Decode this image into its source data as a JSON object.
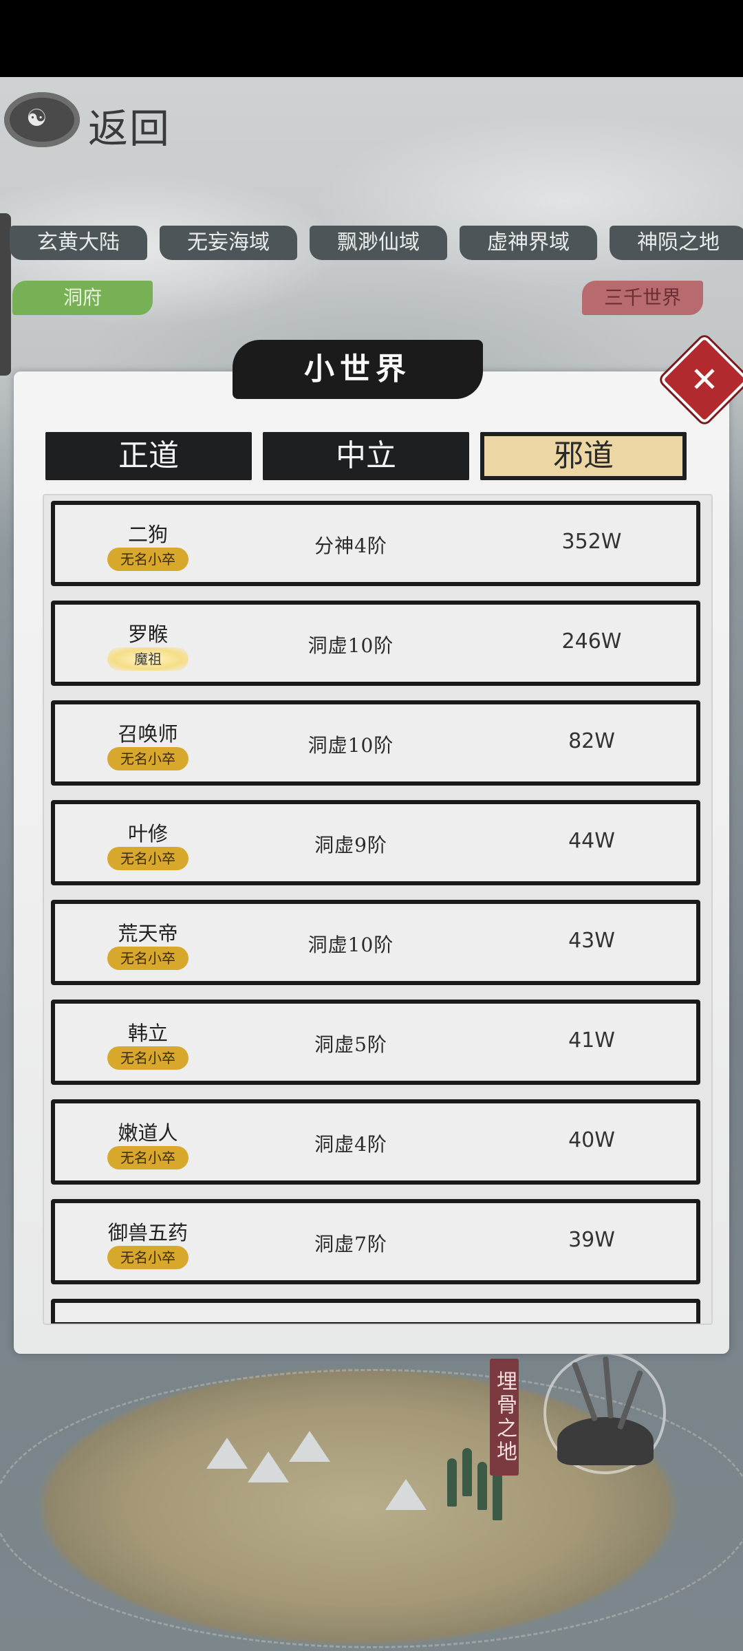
{
  "header": {
    "return_label": "返回"
  },
  "region_tabs": [
    "玄黄大陆",
    "无妄海域",
    "飘渺仙域",
    "虚神界域",
    "神陨之地"
  ],
  "cave_tab": "洞府",
  "three_worlds_tab": "三千世界",
  "dialog": {
    "title": "小世界",
    "close_symbol": "✕",
    "factions": [
      {
        "label": "正道",
        "active": false
      },
      {
        "label": "中立",
        "active": false
      },
      {
        "label": "邪道",
        "active": true
      }
    ],
    "rows": [
      {
        "name": "二狗",
        "title": "无名小卒",
        "realm": "分神4阶",
        "power": "352W"
      },
      {
        "name": "罗睺",
        "title": "魔祖",
        "realm": "洞虚10阶",
        "power": "246W"
      },
      {
        "name": "召唤师",
        "title": "无名小卒",
        "realm": "洞虚10阶",
        "power": "82W"
      },
      {
        "name": "叶修",
        "title": "无名小卒",
        "realm": "洞虚9阶",
        "power": "44W"
      },
      {
        "name": "荒天帝",
        "title": "无名小卒",
        "realm": "洞虚10阶",
        "power": "43W"
      },
      {
        "name": "韩立",
        "title": "无名小卒",
        "realm": "洞虚5阶",
        "power": "41W"
      },
      {
        "name": "嫩道人",
        "title": "无名小卒",
        "realm": "洞虚4阶",
        "power": "40W"
      },
      {
        "name": "御兽五药",
        "title": "无名小卒",
        "realm": "洞虚7阶",
        "power": "39W"
      }
    ]
  },
  "map": {
    "region_sign": "埋骨之地"
  },
  "colors": {
    "accent_gold": "#ecd7a4",
    "title_badge": "#d8a82c",
    "close_red": "#b32a2e",
    "cave_green": "#78b155",
    "three_worlds_red": "#b76b6e"
  }
}
